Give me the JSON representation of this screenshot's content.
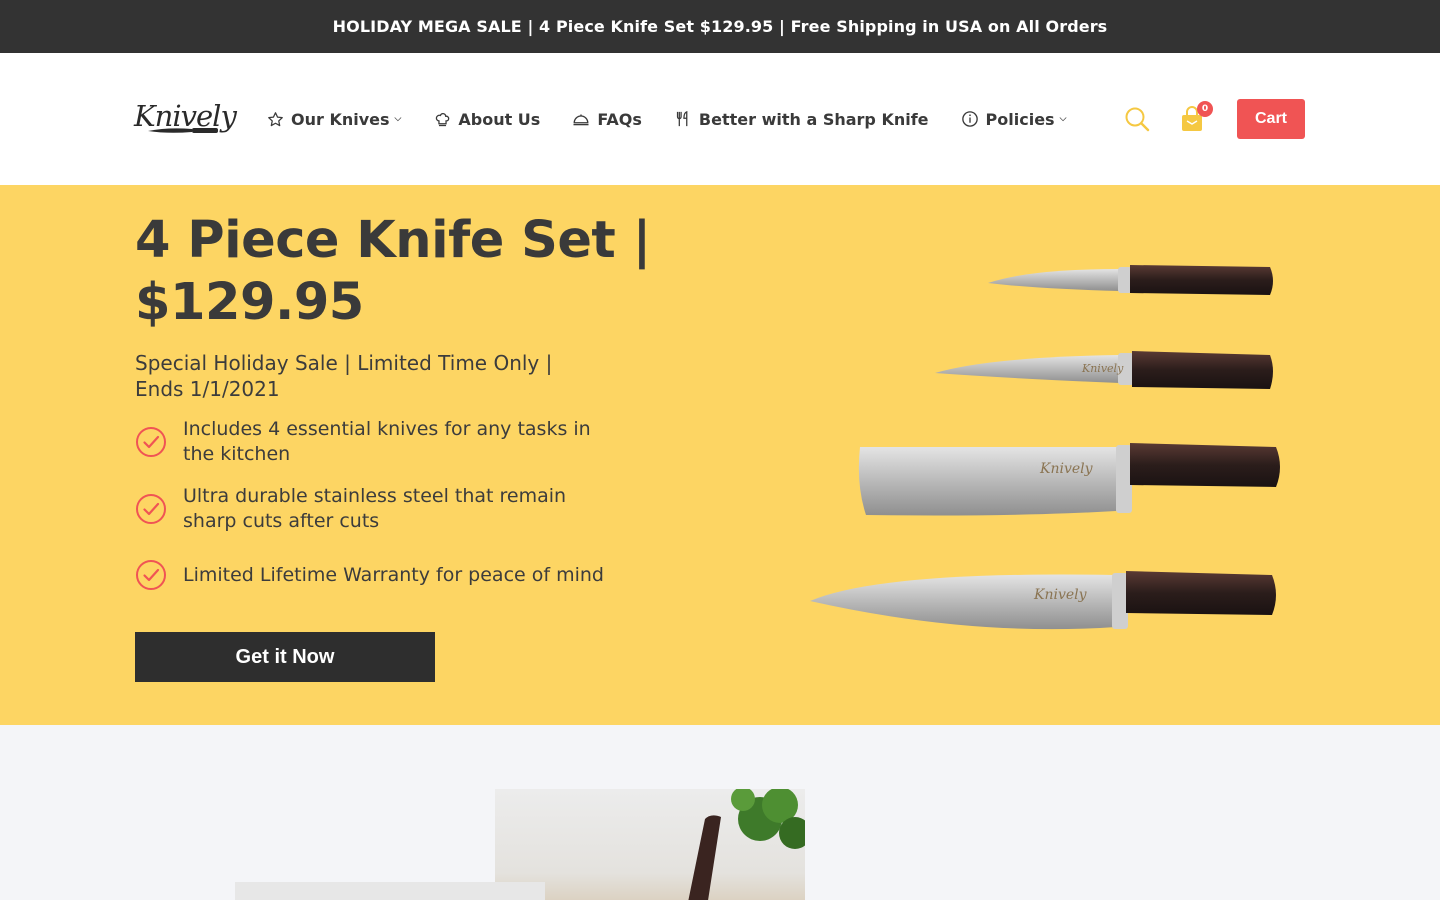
{
  "announcement": {
    "text": "HOLIDAY MEGA SALE | 4 Piece Knife Set $129.95 | Free Shipping in USA on All Orders"
  },
  "header": {
    "logo_text": "Knively",
    "nav": [
      {
        "label": "Our Knives",
        "icon": "star-icon",
        "has_dropdown": true
      },
      {
        "label": "About Us",
        "icon": "chef-hat-icon",
        "has_dropdown": false
      },
      {
        "label": "FAQs",
        "icon": "cloche-icon",
        "has_dropdown": false
      },
      {
        "label": "Better with a Sharp Knife",
        "icon": "utensils-icon",
        "has_dropdown": false
      },
      {
        "label": "Policies",
        "icon": "info-icon",
        "has_dropdown": true
      }
    ],
    "cart_count": "0",
    "cart_label": "Cart"
  },
  "hero": {
    "title": "4 Piece Knife Set | $129.95",
    "subtitle": "Special Holiday Sale | Limited Time Only | Ends 1/1/2021",
    "features": [
      "Includes 4 essential knives for any tasks in the kitchen",
      "Ultra durable stainless steel that remain sharp cuts after cuts",
      "Limited Lifetime Warranty for peace of mind"
    ],
    "cta_label": "Get it Now",
    "knife_brand": "Knively"
  },
  "colors": {
    "announcement_bg": "#333333",
    "hero_bg": "#fdd563",
    "accent": "#f05454",
    "cta_bg": "#2e2e2e",
    "search_icon": "#f5c842"
  }
}
